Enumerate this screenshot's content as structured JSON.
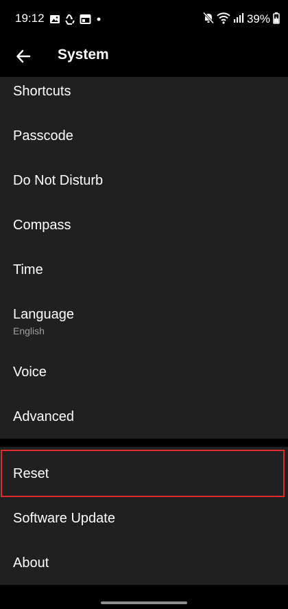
{
  "status_bar": {
    "time": "19:12",
    "battery": "39%",
    "left_icons": [
      "gallery-icon",
      "recycle-icon",
      "calendar-icon",
      "dot-icon"
    ],
    "right_icons": [
      "mute-icon",
      "wifi-icon",
      "signal-icon",
      "battery-icon"
    ]
  },
  "app_bar": {
    "title": "System",
    "back_icon": "arrow-left-icon"
  },
  "menu": {
    "shortcuts": "Shortcuts",
    "passcode": "Passcode",
    "do_not_disturb": "Do Not Disturb",
    "compass": "Compass",
    "time": "Time",
    "language": "Language",
    "language_value": "English",
    "voice": "Voice",
    "advanced": "Advanced",
    "reset": "Reset",
    "software_update": "Software Update",
    "about": "About"
  },
  "colors": {
    "background": "#000000",
    "list_background": "#202020",
    "highlight": "#e4282d",
    "text": "#ffffff",
    "subtext": "#a0a0a0"
  }
}
